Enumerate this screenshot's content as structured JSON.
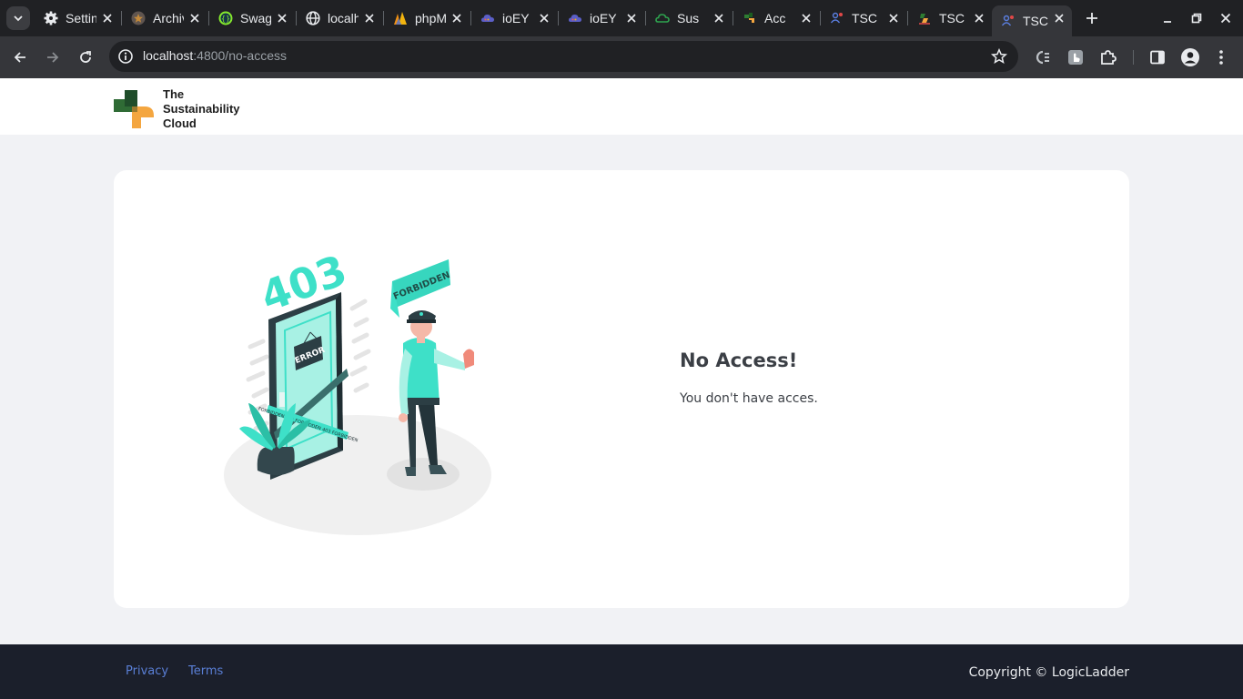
{
  "browser": {
    "tabs": [
      {
        "title": "Settings",
        "icon": "gear-icon"
      },
      {
        "title": "Archive",
        "icon": "archive-icon"
      },
      {
        "title": "Swagger",
        "icon": "swagger-icon"
      },
      {
        "title": "localhost",
        "icon": "globe-icon"
      },
      {
        "title": "phpMyAdmin",
        "icon": "phpmyadmin-icon"
      },
      {
        "title": "ioEY",
        "icon": "cloud-icon"
      },
      {
        "title": "ioEY",
        "icon": "cloud-icon"
      },
      {
        "title": "Sus",
        "icon": "leaf-cloud-icon"
      },
      {
        "title": "Acc",
        "icon": "tsc-logo-icon"
      },
      {
        "title": "TSC",
        "icon": "tsc-people-icon"
      },
      {
        "title": "TSC",
        "icon": "tsc-logo-icon"
      },
      {
        "title": "TSC",
        "icon": "tsc-people-icon",
        "active": true
      }
    ],
    "url_host": "localhost",
    "url_path": ":4800/no-access"
  },
  "header": {
    "logo_line1": "The",
    "logo_line2": "Sustainability",
    "logo_line3": "Cloud"
  },
  "illustration": {
    "code_text": "403",
    "bubble_text": "FORBIDDEN",
    "sign_text": "ERROR",
    "tape_text": "FORBIDDEN 403 FORBIDDEN 403 FORBIDDEN"
  },
  "main": {
    "heading": "No Access!",
    "message": "You don't have acces."
  },
  "footer": {
    "privacy": "Privacy",
    "terms": "Terms",
    "copyright": "Copyright © LogicLadder"
  },
  "colors": {
    "accent": "#3ee0c8",
    "chrome_dark": "#202124",
    "footer_bg": "#1b1f2b",
    "link": "#5a7fd6"
  }
}
